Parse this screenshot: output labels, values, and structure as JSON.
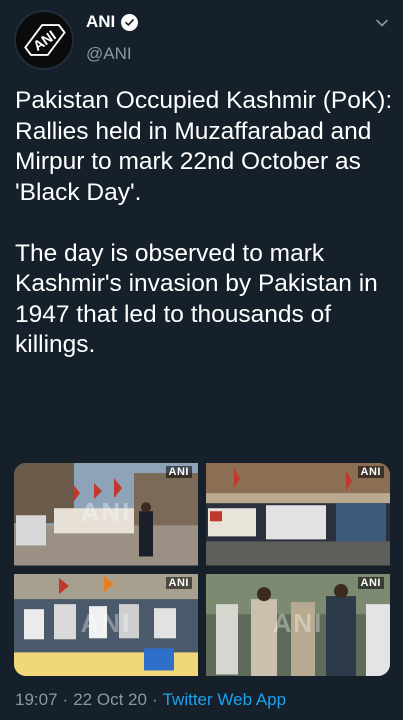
{
  "account": {
    "name": "ANI",
    "handle": "@ANI",
    "avatar_logo_text": "ANI",
    "verified": true
  },
  "tweet": {
    "text": "Pakistan Occupied Kashmir (PoK): Rallies held in Muzaffarabad and Mirpur to mark 22nd October as 'Black Day'.\n\nThe day is observed to mark Kashmir's invasion by Pakistan in 1947 that led to thousands of killings."
  },
  "media": {
    "photos": [
      {
        "tag": "ANI",
        "watermark": "ANI"
      },
      {
        "tag": "ANI",
        "watermark": "ANI"
      },
      {
        "tag": "ANI",
        "watermark": "ANI"
      },
      {
        "tag": "ANI",
        "watermark": "ANI"
      }
    ]
  },
  "meta": {
    "time": "19:07",
    "separator1": "·",
    "date": "22 Oct 20",
    "separator2": "·",
    "source": "Twitter Web App"
  },
  "colors": {
    "background": "#15202b",
    "secondary_text": "#8899a6",
    "link": "#1da1f2"
  },
  "icons": [
    "verified-badge-icon",
    "chevron-down-icon"
  ]
}
